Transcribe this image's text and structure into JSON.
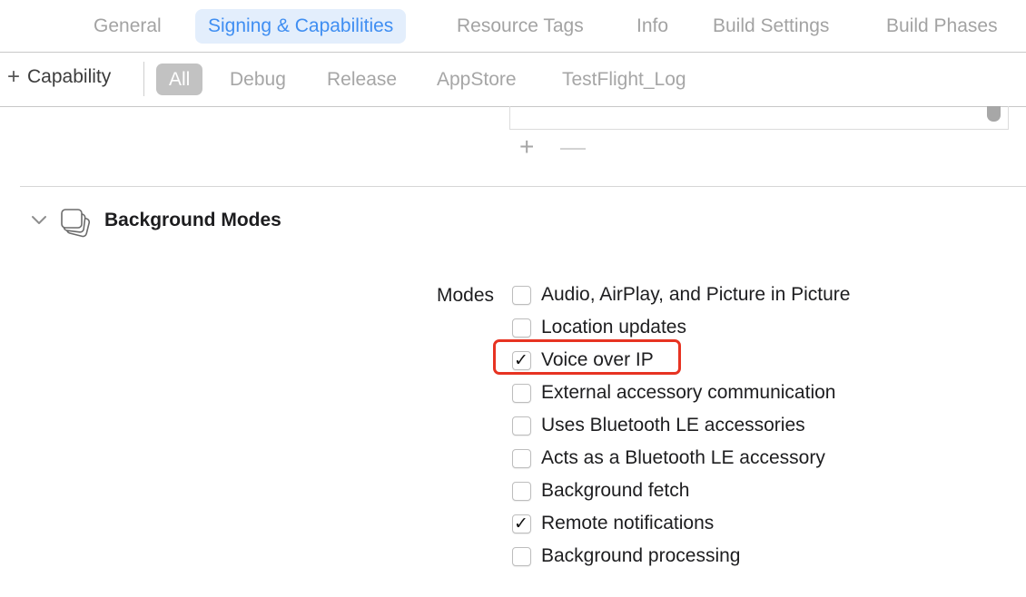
{
  "tabs": [
    {
      "label": "General",
      "active": false
    },
    {
      "label": "Signing & Capabilities",
      "active": true
    },
    {
      "label": "Resource Tags",
      "active": false
    },
    {
      "label": "Info",
      "active": false
    },
    {
      "label": "Build Settings",
      "active": false
    },
    {
      "label": "Build Phases",
      "active": false
    }
  ],
  "toolbar": {
    "add_capability_label": "Capability",
    "filters": [
      {
        "label": "All",
        "active": true
      },
      {
        "label": "Debug",
        "active": false
      },
      {
        "label": "Release",
        "active": false
      },
      {
        "label": "AppStore",
        "active": false
      },
      {
        "label": "TestFlight_Log",
        "active": false
      }
    ]
  },
  "list_controls": {
    "add_icon": "plus-icon",
    "remove_icon": "minus-icon"
  },
  "capability": {
    "icon": "background-modes-icon",
    "title": "Background Modes",
    "modes_label": "Modes",
    "modes": [
      {
        "label": "Audio, AirPlay, and Picture in Picture",
        "checked": false
      },
      {
        "label": "Location updates",
        "checked": false
      },
      {
        "label": "Voice over IP",
        "checked": true
      },
      {
        "label": "External accessory communication",
        "checked": false
      },
      {
        "label": "Uses Bluetooth LE accessories",
        "checked": false
      },
      {
        "label": "Acts as a Bluetooth LE accessory",
        "checked": false
      },
      {
        "label": "Background fetch",
        "checked": false
      },
      {
        "label": "Remote notifications",
        "checked": true
      },
      {
        "label": "Background processing",
        "checked": false
      }
    ]
  },
  "colors": {
    "accent": "#3f8ef2",
    "active_tab_bg": "#e3eefc",
    "highlight": "#e73322"
  }
}
